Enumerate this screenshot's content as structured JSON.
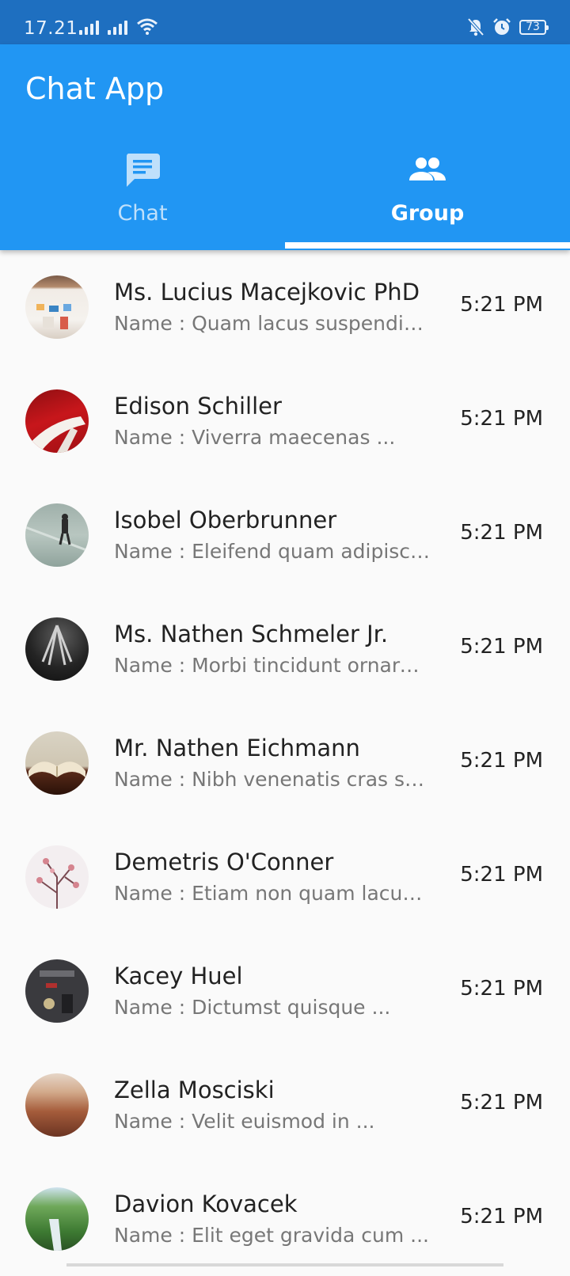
{
  "status": {
    "time": "17.21",
    "battery": "73",
    "icons": [
      "signal-icon",
      "signal-icon",
      "wifi-icon",
      "mute-bell-icon",
      "alarm-icon",
      "battery-icon"
    ]
  },
  "app": {
    "title": "Chat App",
    "primary_color": "#2196f3"
  },
  "tabs": [
    {
      "label": "Chat",
      "icon": "chat-icon",
      "selected": false
    },
    {
      "label": "Group",
      "icon": "group-icon",
      "selected": true
    }
  ],
  "conversations": [
    {
      "name": "Ms. Lucius Macejkovic PhD",
      "message": "Name : Quam lacus suspendisse faucibus",
      "time": "5:21 PM"
    },
    {
      "name": "Edison Schiller",
      "message": "Name : Viverra maecenas ...",
      "time": "5:21 PM"
    },
    {
      "name": "Isobel Oberbrunner",
      "message": "Name : Eleifend quam adipiscing vitae",
      "time": "5:21 PM"
    },
    {
      "name": "Ms. Nathen Schmeler Jr.",
      "message": "Name : Morbi tincidunt ornare ...",
      "time": "5:21 PM"
    },
    {
      "name": "Mr. Nathen Eichmann",
      "message": "Name : Nibh venenatis cras sed felis",
      "time": "5:21 PM"
    },
    {
      "name": "Demetris O'Conner",
      "message": "Name : Etiam non quam lacus ...",
      "time": "5:21 PM"
    },
    {
      "name": "Kacey Huel",
      "message": "Name : Dictumst quisque ...",
      "time": "5:21 PM"
    },
    {
      "name": "Zella Mosciski",
      "message": "Name : Velit euismod in ...",
      "time": "5:21 PM"
    },
    {
      "name": "Davion Kovacek",
      "message": "Name : Elit eget gravida cum ...",
      "time": "5:21 PM"
    }
  ]
}
